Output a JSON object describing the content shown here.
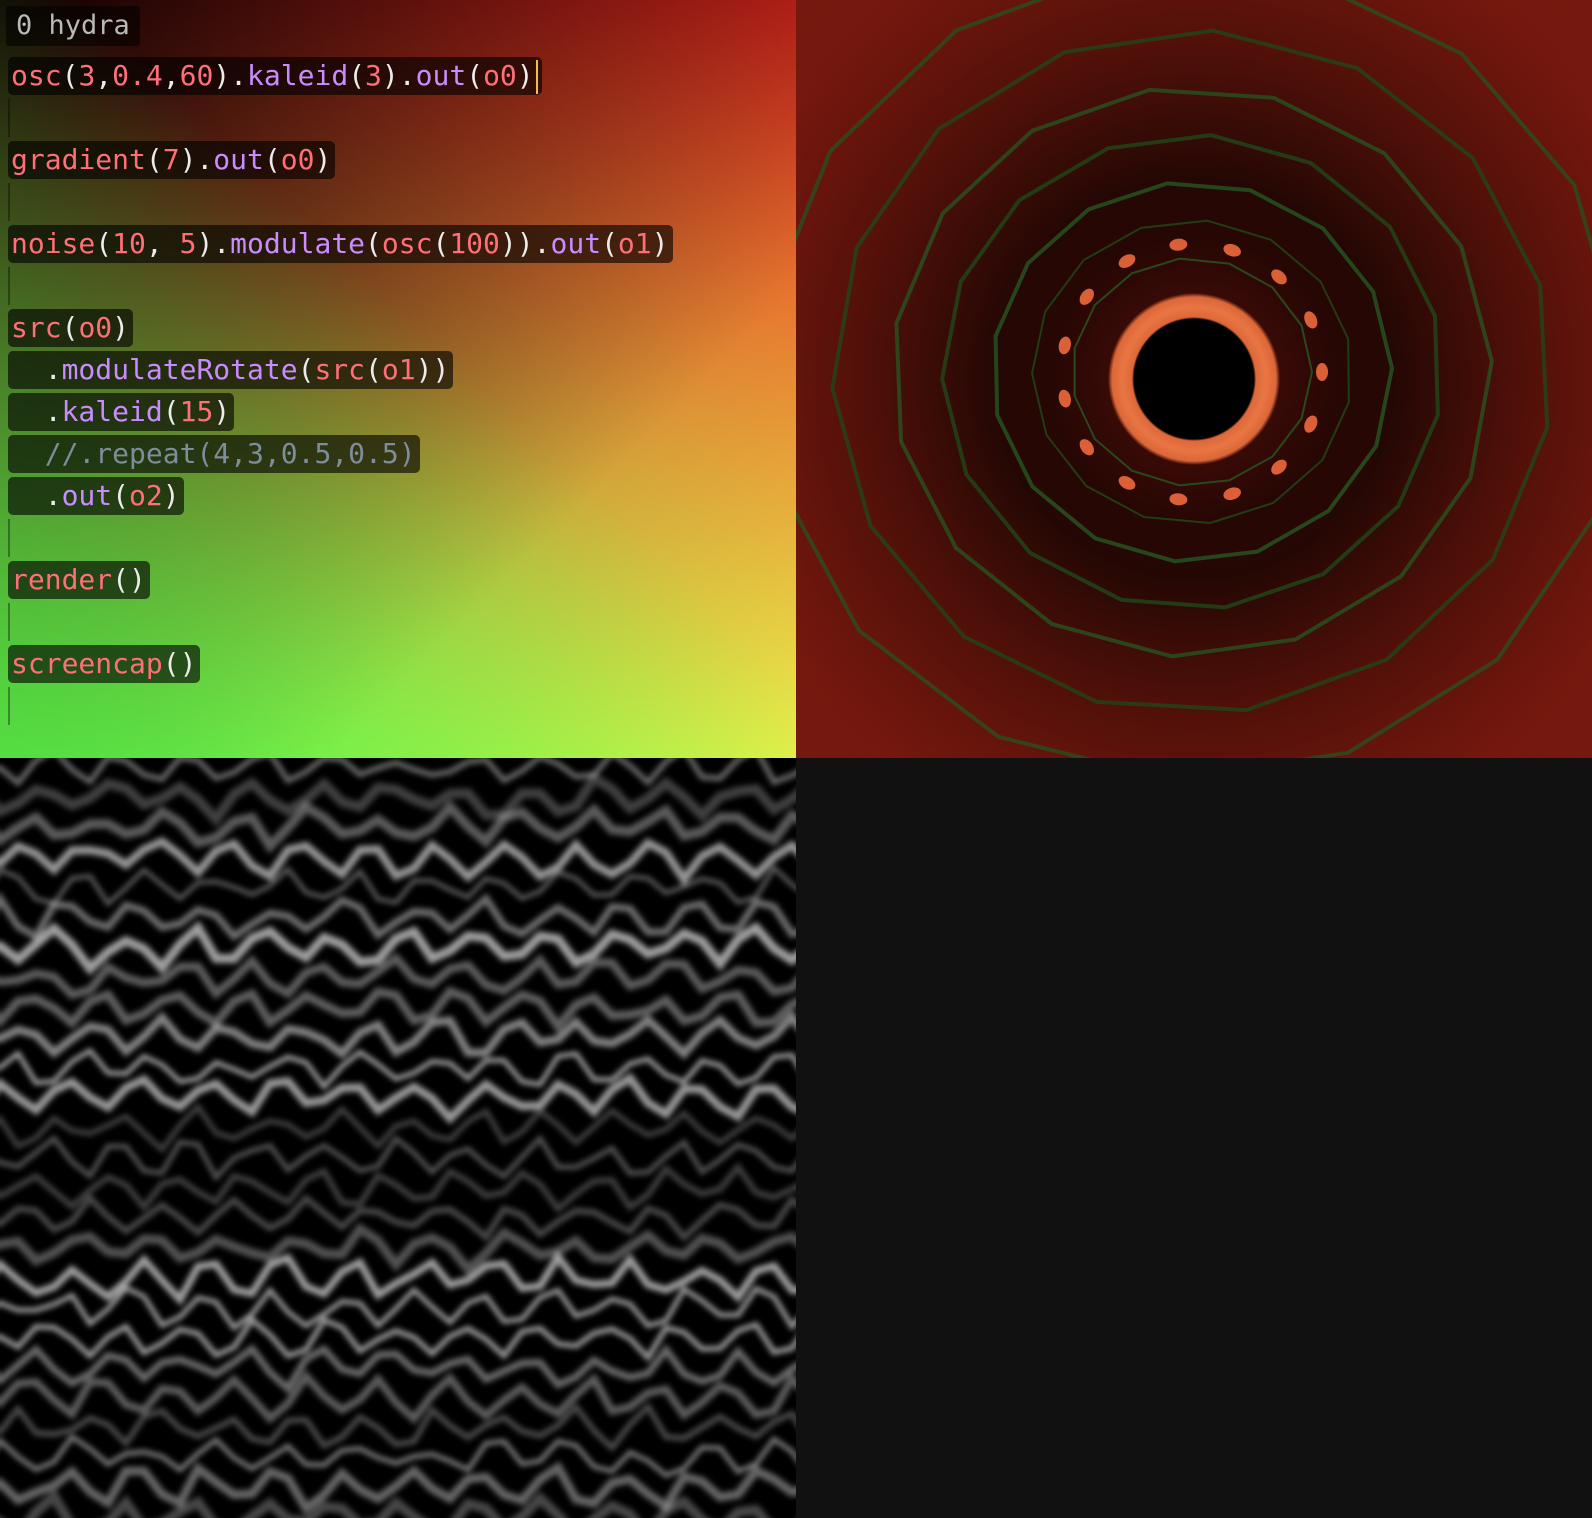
{
  "editor": {
    "title": "0 hydra",
    "lines": [
      {
        "indent": "",
        "tokens": [
          [
            "fn",
            "osc"
          ],
          [
            "punc",
            "("
          ],
          [
            "num",
            "3"
          ],
          [
            "punc",
            ","
          ],
          [
            "num",
            "0.4"
          ],
          [
            "punc",
            ","
          ],
          [
            "num",
            "60"
          ],
          [
            "punc",
            ")."
          ],
          [
            "meth",
            "kaleid"
          ],
          [
            "punc",
            "("
          ],
          [
            "num",
            "3"
          ],
          [
            "punc",
            ")."
          ],
          [
            "meth",
            "out"
          ],
          [
            "punc",
            "("
          ],
          [
            "var",
            "o0"
          ],
          [
            "punc",
            ")"
          ]
        ],
        "cursor": true
      },
      {
        "empty": true
      },
      {
        "indent": "",
        "tokens": [
          [
            "fn",
            "gradient"
          ],
          [
            "punc",
            "("
          ],
          [
            "num",
            "7"
          ],
          [
            "punc",
            ")."
          ],
          [
            "meth",
            "out"
          ],
          [
            "punc",
            "("
          ],
          [
            "var",
            "o0"
          ],
          [
            "punc",
            ")"
          ]
        ]
      },
      {
        "empty": true
      },
      {
        "indent": "",
        "tokens": [
          [
            "fn",
            "noise"
          ],
          [
            "punc",
            "("
          ],
          [
            "num",
            "10"
          ],
          [
            "punc",
            ", "
          ],
          [
            "num",
            "5"
          ],
          [
            "punc",
            ")."
          ],
          [
            "meth",
            "modulate"
          ],
          [
            "punc",
            "("
          ],
          [
            "fn",
            "osc"
          ],
          [
            "punc",
            "("
          ],
          [
            "num",
            "100"
          ],
          [
            "punc",
            "))."
          ],
          [
            "meth",
            "out"
          ],
          [
            "punc",
            "("
          ],
          [
            "var",
            "o1"
          ],
          [
            "punc",
            ")"
          ]
        ]
      },
      {
        "empty": true
      },
      {
        "indent": "",
        "tokens": [
          [
            "fn",
            "src"
          ],
          [
            "punc",
            "("
          ],
          [
            "var",
            "o0"
          ],
          [
            "punc",
            ")"
          ]
        ]
      },
      {
        "indent": "  ",
        "tokens": [
          [
            "punc",
            "."
          ],
          [
            "meth",
            "modulateRotate"
          ],
          [
            "punc",
            "("
          ],
          [
            "fn",
            "src"
          ],
          [
            "punc",
            "("
          ],
          [
            "var",
            "o1"
          ],
          [
            "punc",
            "))"
          ]
        ]
      },
      {
        "indent": "  ",
        "tokens": [
          [
            "punc",
            "."
          ],
          [
            "meth",
            "kaleid"
          ],
          [
            "punc",
            "("
          ],
          [
            "num",
            "15"
          ],
          [
            "punc",
            ")"
          ]
        ]
      },
      {
        "indent": "  ",
        "tokens": [
          [
            "cmt",
            "//.repeat(4,3,0.5,0.5)"
          ]
        ]
      },
      {
        "indent": "  ",
        "tokens": [
          [
            "punc",
            "."
          ],
          [
            "meth",
            "out"
          ],
          [
            "punc",
            "("
          ],
          [
            "var",
            "o2"
          ],
          [
            "punc",
            ")"
          ]
        ]
      },
      {
        "empty": true
      },
      {
        "indent": "",
        "tokens": [
          [
            "fn",
            "render"
          ],
          [
            "punc",
            "()"
          ]
        ]
      },
      {
        "empty": true
      },
      {
        "indent": "",
        "tokens": [
          [
            "fn",
            "screencap"
          ],
          [
            "punc",
            "()"
          ]
        ]
      },
      {
        "empty": true
      }
    ]
  },
  "colors": {
    "function": "#ff6f78",
    "method": "#c98cff",
    "comment": "#7f8c9a",
    "cursor": "#f0c040"
  }
}
